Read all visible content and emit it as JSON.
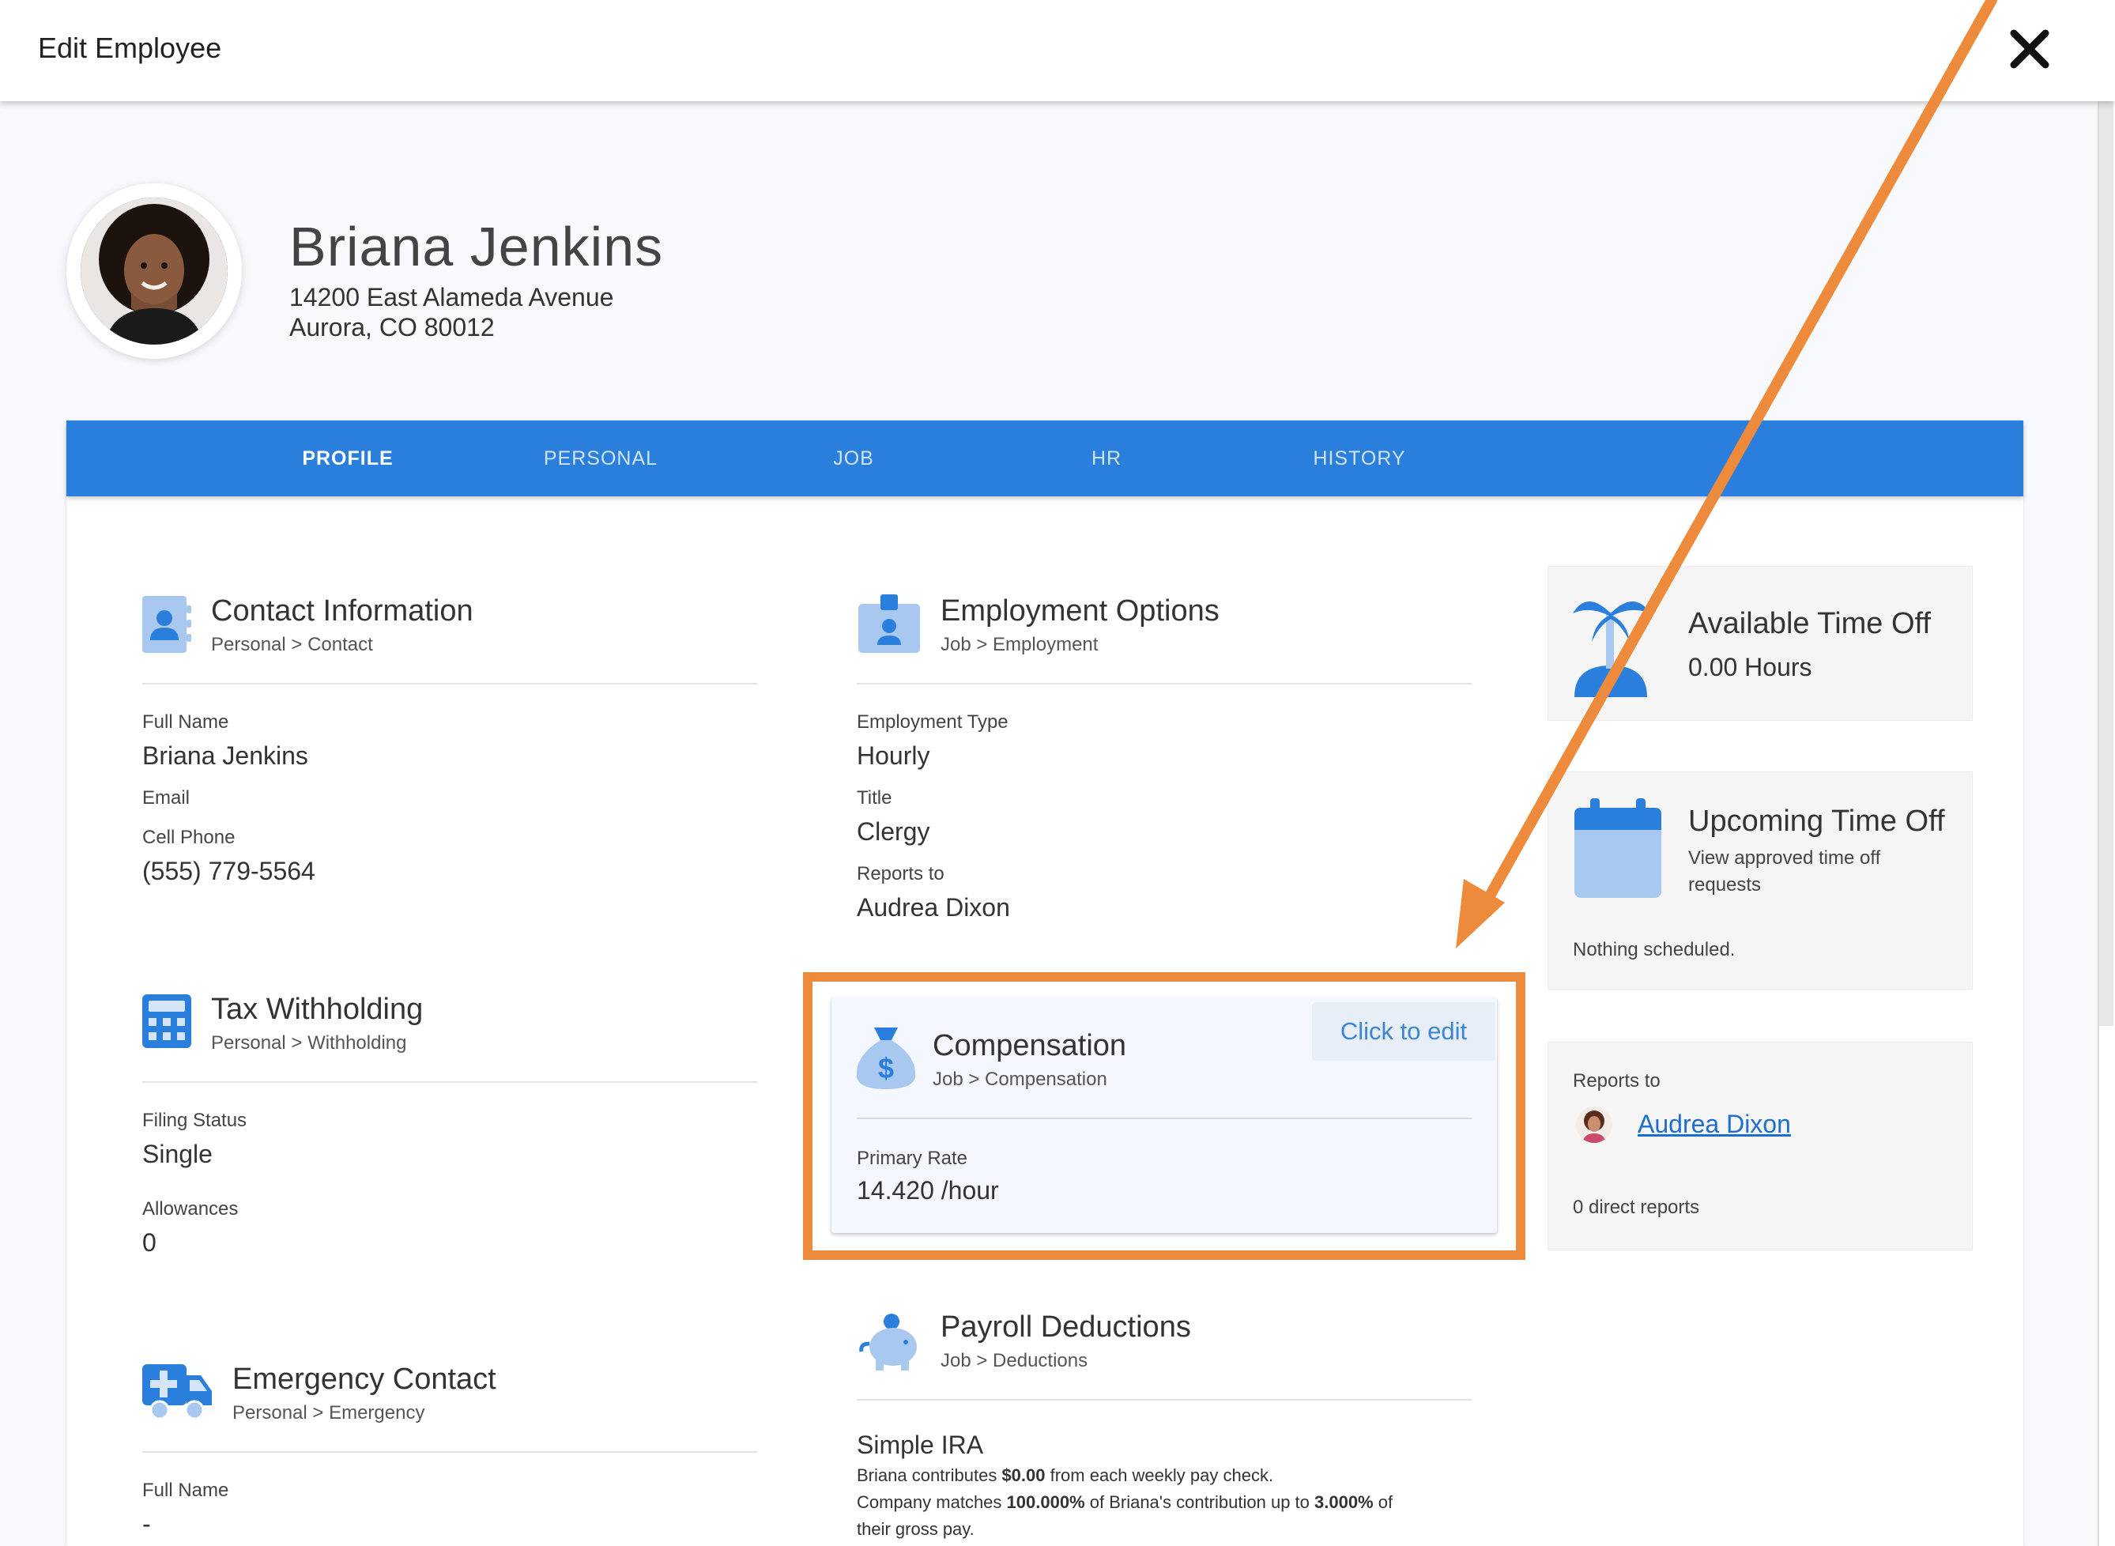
{
  "window": {
    "title": "Edit Employee"
  },
  "employee": {
    "name": "Briana Jenkins",
    "address_line1": "14200 East Alameda Avenue",
    "address_line2": "Aurora, CO 80012"
  },
  "tabs": [
    {
      "label": "PROFILE",
      "active": true
    },
    {
      "label": "PERSONAL"
    },
    {
      "label": "JOB"
    },
    {
      "label": "HR"
    },
    {
      "label": "HISTORY"
    }
  ],
  "contact": {
    "title": "Contact Information",
    "breadcrumb": "Personal > Contact",
    "full_name_label": "Full Name",
    "full_name": "Briana Jenkins",
    "email_label": "Email",
    "cell_label": "Cell Phone",
    "cell": "(555) 779-5564"
  },
  "tax": {
    "title": "Tax Withholding",
    "breadcrumb": "Personal > Withholding",
    "filing_label": "Filing Status",
    "filing": "Single",
    "allowances_label": "Allowances",
    "allowances": "0"
  },
  "emergency": {
    "title": "Emergency Contact",
    "breadcrumb": "Personal > Emergency",
    "full_name_label": "Full Name",
    "full_name": "-"
  },
  "employment": {
    "title": "Employment Options",
    "breadcrumb": "Job > Employment",
    "type_label": "Employment Type",
    "type": "Hourly",
    "title_label": "Title",
    "job_title": "Clergy",
    "reports_label": "Reports to",
    "reports_to": "Audrea Dixon"
  },
  "compensation": {
    "title": "Compensation",
    "breadcrumb": "Job > Compensation",
    "edit_label": "Click to edit",
    "rate_label": "Primary Rate",
    "rate": "14.420 /hour"
  },
  "deductions": {
    "title": "Payroll Deductions",
    "breadcrumb": "Job > Deductions",
    "plan": "Simple IRA",
    "line1_a": "Briana contributes ",
    "line1_amount": "$0.00",
    "line1_b": " from each weekly pay check.",
    "line2_a": "Company matches ",
    "line2_pct": "100.000%",
    "line2_b": " of Briana's contribution up to ",
    "line2_cap": "3.000%",
    "line2_c": " of",
    "line3": "their gross pay."
  },
  "available_time_off": {
    "title": "Available Time Off",
    "hours": "0.00 Hours"
  },
  "upcoming_time_off": {
    "title": "Upcoming Time Off",
    "desc_line1": "View approved time off",
    "desc_line2": "requests",
    "empty": "Nothing scheduled."
  },
  "reports_panel": {
    "label": "Reports to",
    "manager": "Audrea Dixon",
    "direct_reports": "0 direct reports"
  },
  "icons": {
    "close": "close-icon",
    "contact": "contact-card-icon",
    "employment": "id-badge-icon",
    "tax": "calculator-icon",
    "compensation": "money-bag-icon",
    "emergency": "ambulance-icon",
    "deductions": "piggy-bank-icon",
    "time_off": "palm-tree-icon",
    "calendar": "calendar-icon"
  },
  "colors": {
    "tab_bar": "#2a7fdc",
    "highlight": "#ee8a3b",
    "icon_blue": "#2a7fdc",
    "icon_light": "#a9c8f0",
    "link": "#1a6fd0"
  }
}
